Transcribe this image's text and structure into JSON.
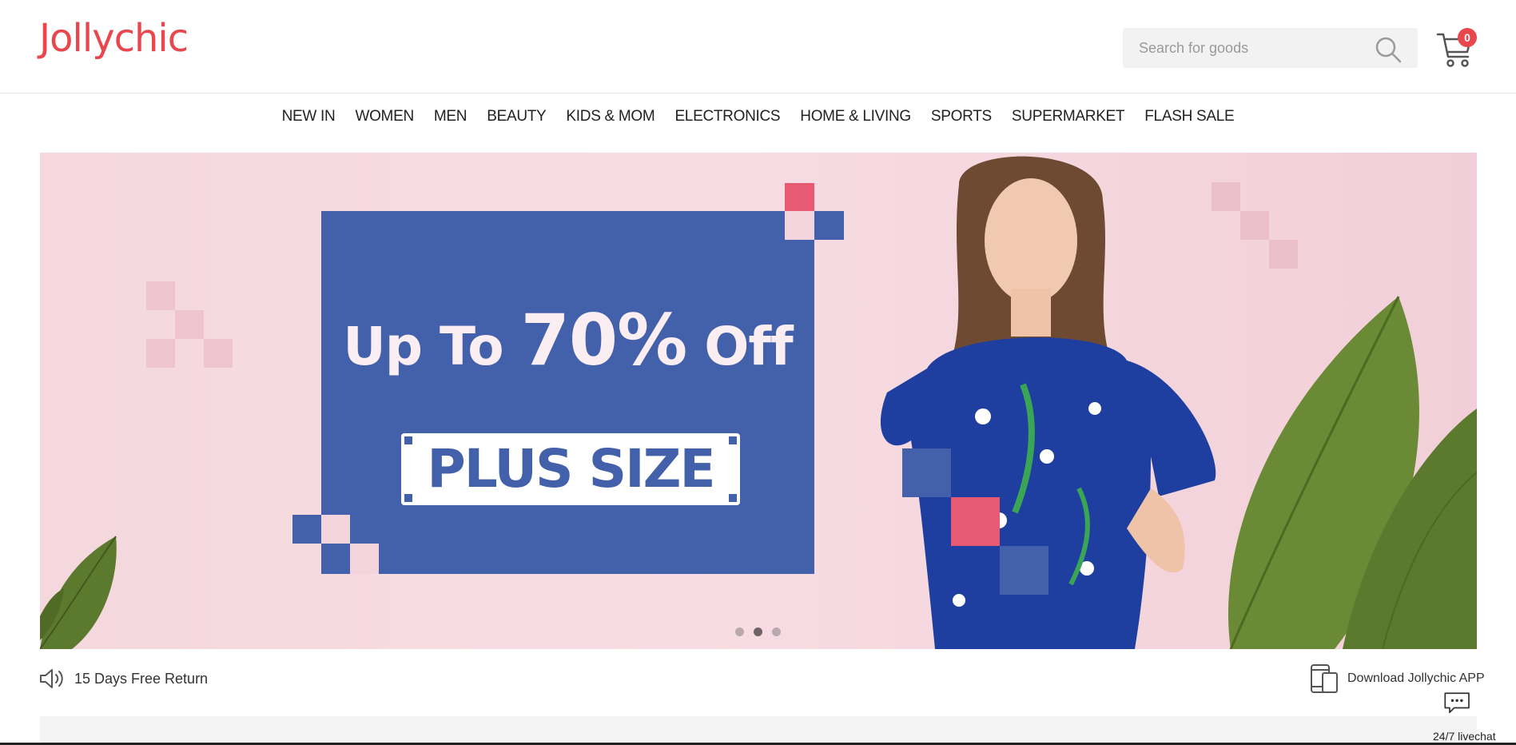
{
  "brand": {
    "logo": "Jollychic",
    "accent_color": "#e8484d"
  },
  "header": {
    "search_placeholder": "Search for goods",
    "search_icon": "search-icon",
    "cart_icon": "cart-icon",
    "cart_count": "0"
  },
  "nav": {
    "items": [
      "NEW IN",
      "WOMEN",
      "MEN",
      "BEAUTY",
      "KIDS & MOM",
      "ELECTRONICS",
      "HOME & LIVING",
      "SPORTS",
      "SUPERMARKET",
      "FLASH SALE"
    ]
  },
  "banner": {
    "headline_prefix": "Up To ",
    "headline_value": "70%",
    "headline_suffix": " Off",
    "tag": "PLUS SIZE",
    "slide_count": 3,
    "active_slide": 2,
    "colors": {
      "box": "#4361ab",
      "pink": "#e85a72",
      "background": "#f4d8de"
    }
  },
  "info_bar": {
    "left_icon": "speaker-icon",
    "left_text": "15 Days Free Return",
    "right_icon": "phone-icon",
    "right_text": "Download Jollychic APP"
  },
  "livechat": {
    "icon": "chat-bubble-icon",
    "label": "24/7 livechat"
  }
}
